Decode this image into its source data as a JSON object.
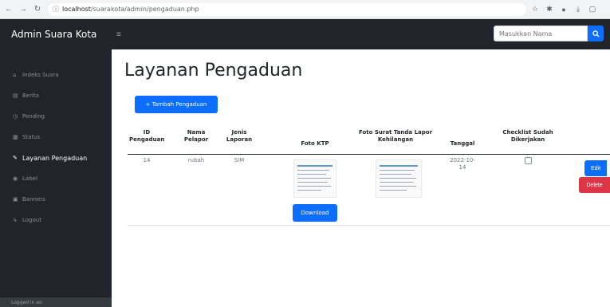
{
  "browser": {
    "back_icon": "arrow-left",
    "forward_icon": "arrow-right",
    "reload_icon": "reload",
    "info_icon": "info",
    "url_host": "localhost",
    "url_path": "/suarakota/admin/pengaduan.php",
    "toolbar_icons": [
      "star-icon",
      "extension-icon",
      "profile-icon",
      "menu-icon"
    ]
  },
  "navbar": {
    "brand": "Admin Suara Kota",
    "menu_icon": "≡",
    "search_placeholder": "Masukkan Nama",
    "search_icon": "search"
  },
  "sidebar": {
    "items": [
      {
        "label": "Indeks Suara",
        "icon": "home-icon"
      },
      {
        "label": "Berita",
        "icon": "news-icon"
      },
      {
        "label": "Pending",
        "icon": "clock-icon"
      },
      {
        "label": "Status",
        "icon": "chart-icon"
      },
      {
        "label": "Layanan Pengaduan",
        "icon": "pencil-icon",
        "active": true
      },
      {
        "label": "Label",
        "icon": "tag-icon"
      },
      {
        "label": "Banners",
        "icon": "image-icon"
      },
      {
        "label": "Logout",
        "icon": "logout-icon"
      }
    ],
    "footer": "Logged in as:"
  },
  "main": {
    "title": "Layanan Pengaduan",
    "add_button": "+ Tambah Pengaduan",
    "table": {
      "headers": [
        "ID Pengaduan",
        "Nama Pelapor",
        "Jenis Laporan",
        "Foto KTP",
        "Foto Surat Tanda Lapor Kehilangan",
        "Tanggal",
        "Checklist Sudah Dikerjakan"
      ],
      "rows": [
        {
          "id": "14",
          "nama": "rubah",
          "jenis": "SIM",
          "tanggal": "2022-10-14",
          "download_label": "Download",
          "checked": false,
          "edit_label": "Edit",
          "delete_label": "Delete"
        }
      ]
    }
  },
  "colors": {
    "primary": "#0d6efd",
    "danger": "#dc3545",
    "dark": "#212529"
  }
}
